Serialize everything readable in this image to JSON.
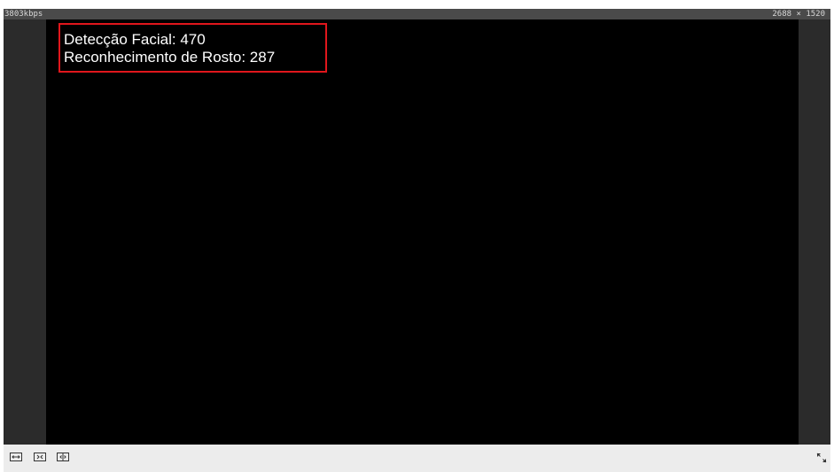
{
  "status_bar": {
    "bitrate": "3803kbps",
    "resolution": "2688 × 1520"
  },
  "osd": {
    "face_detection": "Detecção Facial: 470",
    "face_recognition": "Reconhecimento de Rosto: 287",
    "box_color": "#e0161c"
  },
  "toolbar": {
    "icons": [
      "fit-window-icon",
      "stretch-icon",
      "original-size-icon",
      "fullscreen-icon"
    ]
  }
}
